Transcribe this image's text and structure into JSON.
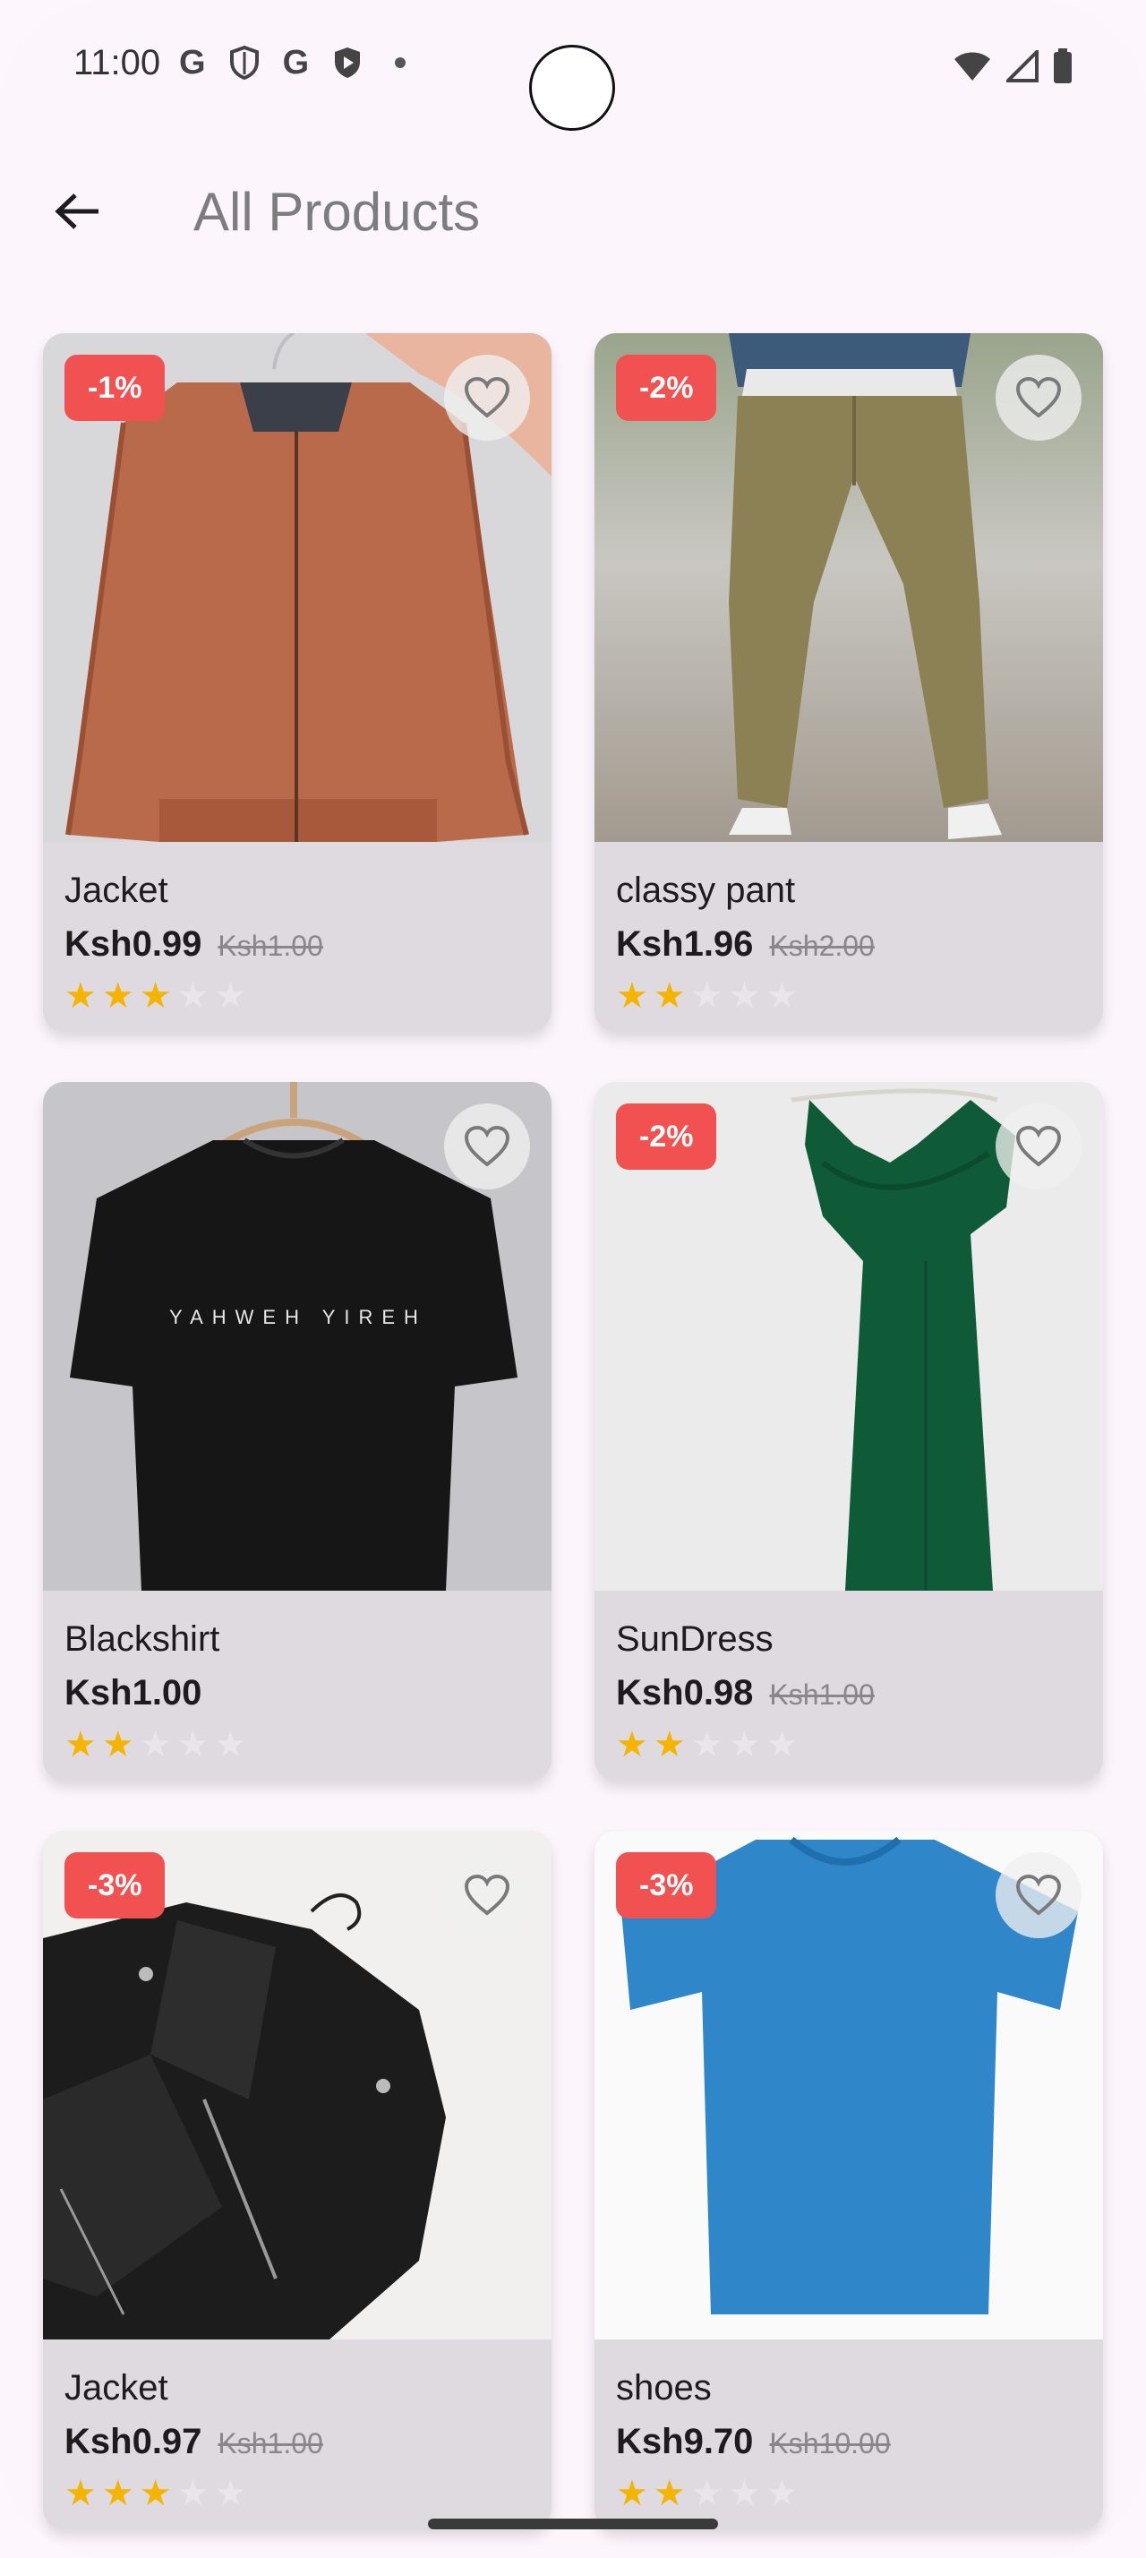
{
  "status_bar": {
    "time": "11:00"
  },
  "app_bar": {
    "title": "All Products"
  },
  "products": [
    {
      "name": "Jacket",
      "price": "Ksh0.99",
      "old_price": "Ksh1.00",
      "discount": "-1%",
      "rating": 3,
      "image": "orange-bomber-jacket"
    },
    {
      "name": "classy pant",
      "price": "Ksh1.96",
      "old_price": "Ksh2.00",
      "discount": "-2%",
      "rating": 2,
      "image": "khaki-pants"
    },
    {
      "name": "Blackshirt",
      "price": "Ksh1.00",
      "old_price": "",
      "discount": "",
      "rating": 2,
      "image": "black-tshirt",
      "shirt_text": "YAHWEH YIREH"
    },
    {
      "name": "SunDress",
      "price": "Ksh0.98",
      "old_price": "Ksh1.00",
      "discount": "-2%",
      "rating": 2,
      "image": "green-dress"
    },
    {
      "name": "Jacket",
      "price": "Ksh0.97",
      "old_price": "Ksh1.00",
      "discount": "-3%",
      "rating": 3,
      "image": "black-leather-jacket"
    },
    {
      "name": "shoes",
      "price": "Ksh9.70",
      "old_price": "Ksh10.00",
      "discount": "-3%",
      "rating": 2,
      "image": "blue-tshirt"
    }
  ],
  "colors": {
    "badge": "#f25151",
    "star": "#f5b400",
    "card": "#dfdadf",
    "background": "#fcf5fc"
  }
}
